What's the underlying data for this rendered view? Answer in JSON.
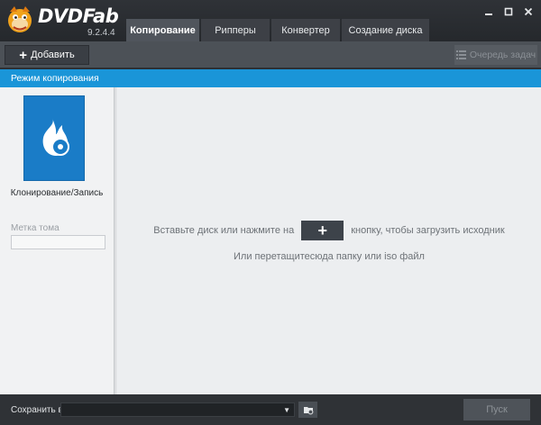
{
  "app": {
    "name": "DVDFab",
    "version": "9.2.4.4"
  },
  "tabs": [
    {
      "label": "Копирование",
      "active": true
    },
    {
      "label": "Рипперы",
      "active": false
    },
    {
      "label": "Конвертер",
      "active": false
    },
    {
      "label": "Создание диска",
      "active": false
    }
  ],
  "window_controls": {
    "minimize_icon": "minimize-icon",
    "restore_icon": "restore-icon",
    "close_icon": "close-icon"
  },
  "toolbar": {
    "add_label": "Добавить",
    "queue_label": "Очередь задач"
  },
  "mode_bar": {
    "label": "Режим копирования"
  },
  "left_panel": {
    "mode_name": "Клонирование/Запись",
    "volume_label": "Метка тома",
    "volume_value": ""
  },
  "main": {
    "hint_before": "Вставьте диск или нажмите на",
    "hint_after": "кнопку, чтобы загрузить исходник",
    "hint_line2": "Или перетащитесюда папку или iso файл"
  },
  "bottom": {
    "save_label": "Сохранить в:",
    "save_value": "",
    "start_label": "Пуск"
  },
  "colors": {
    "accent": "#1a95d8",
    "mode_card": "#1a7cc7",
    "chrome_dark": "#2d3034"
  }
}
